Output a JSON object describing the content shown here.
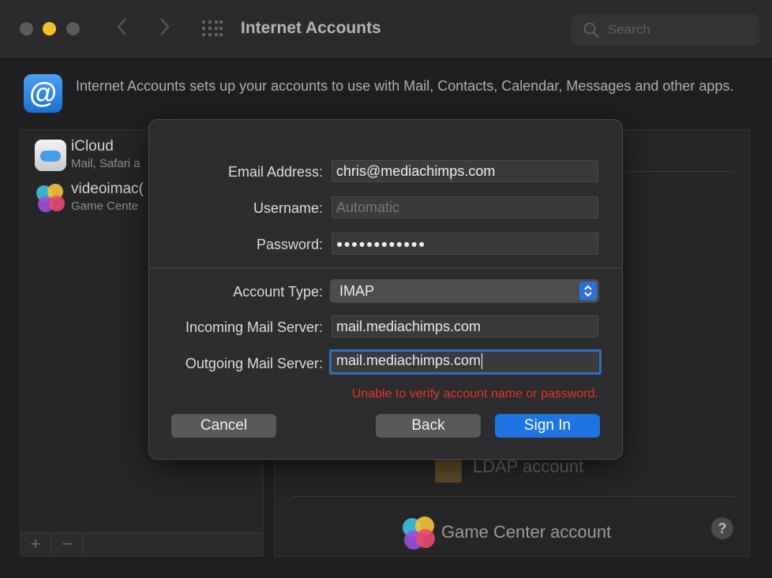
{
  "window": {
    "title": "Internet Accounts",
    "search_placeholder": "Search"
  },
  "header": {
    "icon_glyph": "@",
    "description": "Internet Accounts sets up your accounts to use with Mail, Contacts, Calendar, Messages and other apps."
  },
  "sidebar": {
    "accounts": [
      {
        "name": "iCloud",
        "subtitle": "Mail, Safari a",
        "icon": "icloud-icon"
      },
      {
        "name": "videoimac(",
        "subtitle": "Game Cente",
        "icon": "game-center-icon"
      }
    ],
    "add_label": "+",
    "remove_label": "−"
  },
  "right_panel": {
    "items": [
      "LDAP account",
      "Game Center account"
    ],
    "help_label": "?"
  },
  "dialog": {
    "email_label": "Email Address:",
    "email_value": "chris@mediachimps.com",
    "username_label": "Username:",
    "username_placeholder": "Automatic",
    "password_label": "Password:",
    "password_value": "●●●●●●●●●●●●",
    "account_type_label": "Account Type:",
    "account_type_value": "IMAP",
    "incoming_label": "Incoming Mail Server:",
    "incoming_value": "mail.mediachimps.com",
    "outgoing_label": "Outgoing Mail Server:",
    "outgoing_value": "mail.mediachimps.com",
    "error_message": "Unable to verify account name or password.",
    "cancel_label": "Cancel",
    "back_label": "Back",
    "signin_label": "Sign In"
  },
  "colors": {
    "accent": "#1e74e0",
    "error": "#e0362c",
    "minimize": "#f5bf2f"
  }
}
